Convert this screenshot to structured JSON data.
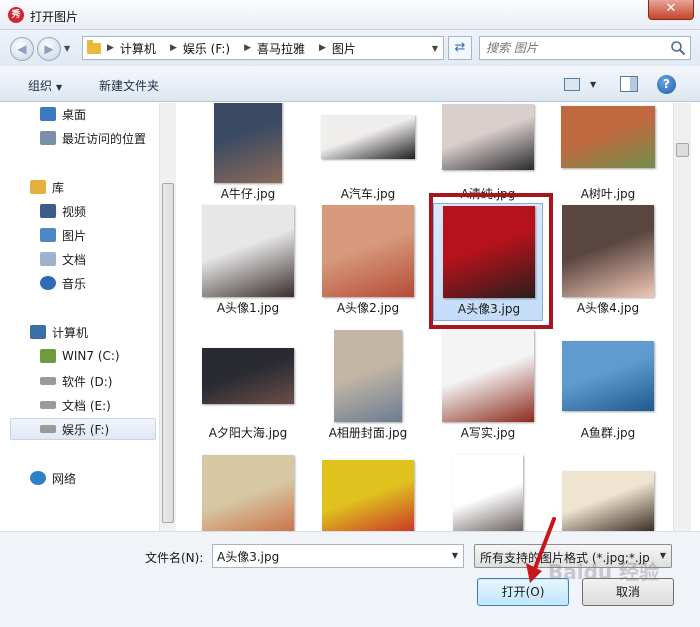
{
  "window": {
    "title": "打开图片",
    "close_label": "✕"
  },
  "address": {
    "crumbs": [
      "计算机",
      "娱乐 (F:)",
      "喜马拉雅",
      "图片"
    ],
    "search_placeholder": "搜索 图片"
  },
  "toolbar": {
    "organize_label": "组织",
    "new_folder_label": "新建文件夹"
  },
  "sidebar": {
    "items": [
      {
        "label": "桌面",
        "icon": "desktop-icon",
        "color": "#3a78c2"
      },
      {
        "label": "最近访问的位置",
        "icon": "recent-places-icon",
        "color": "#7a8fa8"
      },
      {
        "label": "库",
        "icon": "libraries-icon",
        "color": "#e3b03d"
      },
      {
        "label": "视频",
        "icon": "videos-icon",
        "color": "#3a5b8c"
      },
      {
        "label": "图片",
        "icon": "pictures-icon",
        "color": "#4f86c6"
      },
      {
        "label": "文档",
        "icon": "documents-icon",
        "color": "#9fb4cc"
      },
      {
        "label": "音乐",
        "icon": "music-icon",
        "color": "#2f6bb5"
      },
      {
        "label": "计算机",
        "icon": "computer-icon",
        "color": "#3b6fa8"
      },
      {
        "label": "WIN7 (C:)",
        "icon": "drive-c-icon",
        "color": "#6f9c3c"
      },
      {
        "label": "软件 (D:)",
        "icon": "drive-icon",
        "color": "#9a9a9a"
      },
      {
        "label": "文档 (E:)",
        "icon": "drive-icon",
        "color": "#9a9a9a"
      },
      {
        "label": "娱乐 (F:)",
        "icon": "drive-icon",
        "color": "#9a9a9a"
      },
      {
        "label": "网络",
        "icon": "network-icon",
        "color": "#2e7fc8"
      }
    ],
    "selected_index": 11
  },
  "files": [
    {
      "name": "A牛仔.jpg",
      "colors": [
        "#3b4a63",
        "#8c6b5a"
      ]
    },
    {
      "name": "A汽车.jpg",
      "colors": [
        "#f0eded",
        "#1e1e1e"
      ]
    },
    {
      "name": "A清纯.jpg",
      "colors": [
        "#d9cfcd",
        "#2c2a2f"
      ]
    },
    {
      "name": "A树叶.jpg",
      "colors": [
        "#c0683f",
        "#6f8f4a"
      ]
    },
    {
      "name": "A头像1.jpg",
      "colors": [
        "#e7e7e7",
        "#3a2f2d"
      ]
    },
    {
      "name": "A头像2.jpg",
      "colors": [
        "#d79a7d",
        "#b54c36"
      ]
    },
    {
      "name": "A头像3.jpg",
      "colors": [
        "#b5121b",
        "#2a1e1c"
      ]
    },
    {
      "name": "A头像4.jpg",
      "colors": [
        "#5a4640",
        "#f1c8b6"
      ]
    },
    {
      "name": "A夕阳大海.jpg",
      "colors": [
        "#2a2a32",
        "#6b4f48"
      ]
    },
    {
      "name": "A相册封面.jpg",
      "colors": [
        "#c4b6a4",
        "#6a7c93"
      ]
    },
    {
      "name": "A写实.jpg",
      "colors": [
        "#f4f4f4",
        "#8a2a1e"
      ]
    },
    {
      "name": "A鱼群.jpg",
      "colors": [
        "#5f9bcf",
        "#1f5a8f"
      ]
    },
    {
      "name": "",
      "colors": [
        "#d7c7a3",
        "#c65a2f"
      ]
    },
    {
      "name": "",
      "colors": [
        "#e0c21e",
        "#c41e2a"
      ]
    },
    {
      "name": "",
      "colors": [
        "#ffffff",
        "#3a2d2b"
      ]
    },
    {
      "name": "",
      "colors": [
        "#efe4cf",
        "#3a2f24"
      ]
    }
  ],
  "selected_file_index": 6,
  "bottom": {
    "filename_label": "文件名(N):",
    "filename_value": "A头像3.jpg",
    "filetype_value": "所有支持的图片格式 (*.jpg;*.jp",
    "open_label": "打开(O)",
    "cancel_label": "取消"
  },
  "watermark": "Baidu 经验"
}
